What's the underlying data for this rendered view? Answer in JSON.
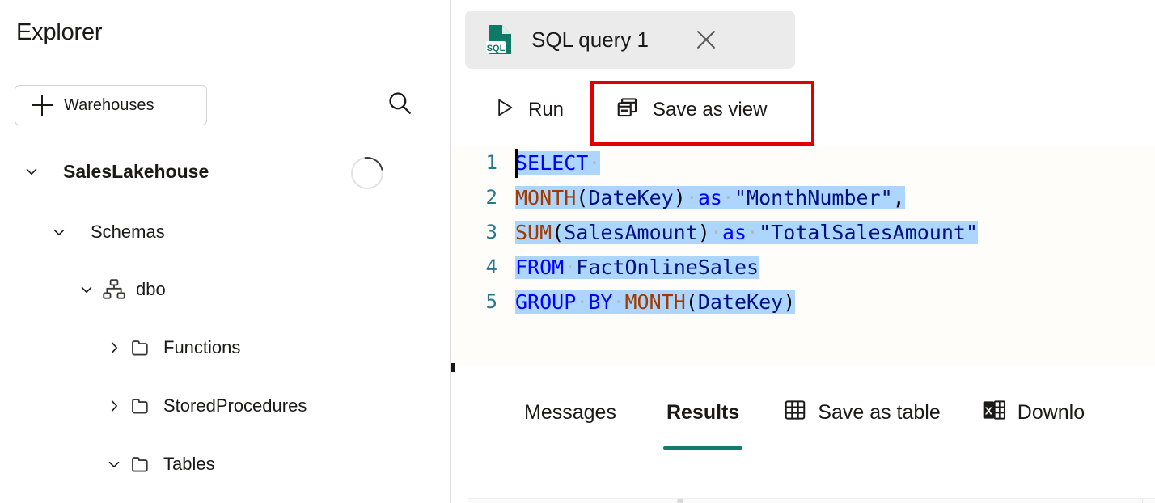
{
  "sidebar": {
    "title": "Explorer",
    "add_button": {
      "label": "Warehouses",
      "icon": "plus-icon"
    },
    "search": {
      "icon": "search-icon",
      "tooltip": "Search"
    },
    "tree": [
      {
        "label": "SalesLakehouse",
        "expanded": true,
        "icon": "none",
        "level": 0,
        "bold": true,
        "loading": true
      },
      {
        "label": "Schemas",
        "expanded": true,
        "icon": "none",
        "level": 1,
        "bold": false,
        "loading": false
      },
      {
        "label": "dbo",
        "expanded": true,
        "icon": "schema-icon",
        "level": 2,
        "bold": false,
        "loading": false
      },
      {
        "label": "Functions",
        "expanded": false,
        "icon": "folder-icon",
        "level": 3,
        "bold": false,
        "loading": false
      },
      {
        "label": "StoredProcedures",
        "expanded": false,
        "icon": "folder-icon",
        "level": 3,
        "bold": false,
        "loading": false
      },
      {
        "label": "Tables",
        "expanded": true,
        "icon": "folder-icon",
        "level": 3,
        "bold": false,
        "loading": false
      }
    ]
  },
  "tab": {
    "title": "SQL query 1",
    "icon": "sql-file-icon",
    "icon_text": "SQL",
    "close_icon": "close-icon",
    "active": true
  },
  "toolbar": {
    "run": {
      "label": "Run",
      "icon": "play-icon"
    },
    "save_as_view": {
      "label": "Save as view",
      "icon": "view-stack-icon",
      "highlighted": true
    },
    "highlight_color": "#e00000"
  },
  "editor": {
    "line_numbers": [
      "1",
      "2",
      "3",
      "4",
      "5"
    ],
    "lines": [
      "SELECT ",
      "MONTH(DateKey) as \"MonthNumber\",",
      "SUM(SalesAmount) as \"TotalSalesAmount\"",
      "FROM FactOnlineSales",
      "GROUP BY MONTH(DateKey)"
    ],
    "selection_color": "#add6ff",
    "all_selected": true,
    "caret_line": 1
  },
  "results_pane": {
    "tabs": [
      {
        "label": "Messages",
        "active": false
      },
      {
        "label": "Results",
        "active": true
      }
    ],
    "actions": [
      {
        "label": "Save as table",
        "icon": "table-grid-icon"
      },
      {
        "label": "Downlo",
        "icon": "excel-icon"
      }
    ],
    "active_underline_color": "#107c6e"
  }
}
